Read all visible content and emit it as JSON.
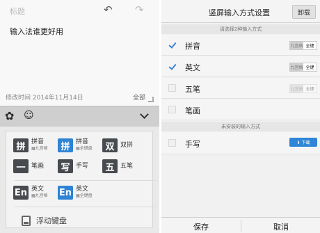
{
  "editor": {
    "title_placeholder": "标题",
    "undo_glyph": "↶",
    "redo_glyph": "↷",
    "content": "输入法谁更好用",
    "modified": "修改时间 2014年11月14日",
    "scope": "全部"
  },
  "toolbar": {
    "gear_glyph": "✿",
    "emoji_glyph": "☺"
  },
  "ime_panel": {
    "items": [
      {
        "tile": "拼",
        "name": "拼音",
        "sub": "▦九宫格"
      },
      {
        "tile": "拼",
        "name": "拼音",
        "sub": "▦全键盘",
        "selected": true
      },
      {
        "tile": "双",
        "name": "双拼",
        "sub": ""
      },
      {
        "tile": "一",
        "name": "笔画",
        "sub": ""
      },
      {
        "tile": "写",
        "name": "手写",
        "sub": ""
      },
      {
        "tile": "五",
        "name": "五笔",
        "sub": ""
      },
      {
        "tile": "En",
        "name": "英文",
        "sub": "▦九宫格"
      },
      {
        "tile": "En",
        "name": "英文",
        "sub": "▦全键盘",
        "selected": true
      }
    ],
    "float_label": "浮动键盘"
  },
  "settings": {
    "title": "竖屏输入方式设置",
    "uninstall_label": "卸载",
    "section_installed": "请选择2种输入方式",
    "section_not_installed": "未安装的输入方式",
    "rows": [
      {
        "name": "拼音",
        "checked": true,
        "seg_a": "九宫格",
        "seg_b": "全键"
      },
      {
        "name": "英文",
        "checked": true,
        "seg_a": "九宫格",
        "seg_b": "全键"
      },
      {
        "name": "五笔",
        "checked": false,
        "seg_a": "九宫格",
        "seg_b": "全键"
      },
      {
        "name": "笔画",
        "checked": false
      }
    ],
    "uninstalled_row": {
      "name": "手写",
      "download_label": "⬇ 下载"
    },
    "save_label": "保存",
    "cancel_label": "取消"
  },
  "colors": {
    "accent": "#2f86d6",
    "tile": "#474a4f"
  }
}
